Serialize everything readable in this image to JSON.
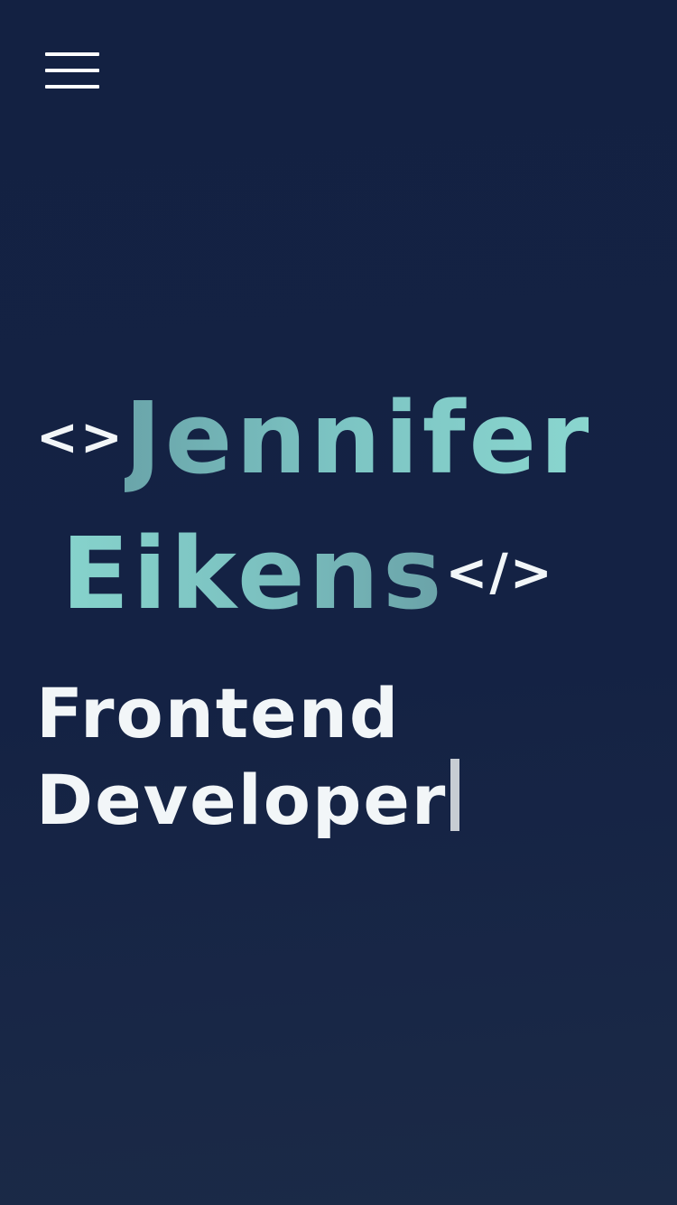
{
  "header": {
    "menu_icon": "hamburger-menu-icon"
  },
  "hero": {
    "open_tag": "<>",
    "first_name": "Jennifer",
    "last_name": "Eikens",
    "close_tag": "</>",
    "role_line1": "Frontend",
    "role_line2": "Developer",
    "cursor": "|"
  },
  "colors": {
    "background": "#132142",
    "accent": "#7cc4c3",
    "text": "#f2f6f8",
    "cursor": "#c7ccd3"
  }
}
